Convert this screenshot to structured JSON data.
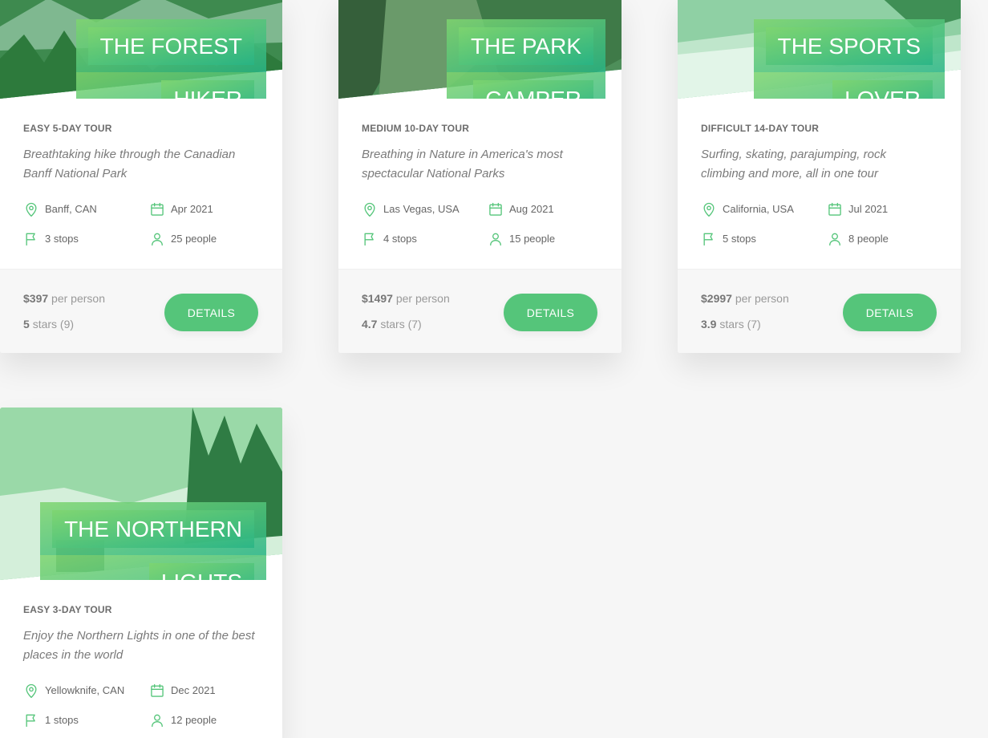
{
  "colors": {
    "accent": "#55c57a",
    "gradient_start": "#7ed56f",
    "gradient_end": "#28b485",
    "background": "#f6f6f6"
  },
  "icons": {
    "location": "map-pin-icon",
    "date": "calendar-icon",
    "stops": "flag-icon",
    "people": "user-icon"
  },
  "tours": [
    {
      "title_lines": [
        "THE FOREST",
        "HIKER"
      ],
      "subtitle": "EASY 5-DAY TOUR",
      "description": "Breathtaking hike through the Canadian Banff National Park",
      "location": "Banff, CAN",
      "date": "Apr 2021",
      "stops": "3 stops",
      "people": "25 people",
      "price": "$397",
      "price_unit": "per person",
      "rating_value": "5",
      "rating_unit": "stars",
      "rating_count": "(9)",
      "button_label": "DETAILS"
    },
    {
      "title_lines": [
        "THE PARK",
        "CAMPER"
      ],
      "subtitle": "MEDIUM 10-DAY TOUR",
      "description": "Breathing in Nature in America's most spectacular National Parks",
      "location": "Las Vegas, USA",
      "date": "Aug 2021",
      "stops": "4 stops",
      "people": "15 people",
      "price": "$1497",
      "price_unit": "per person",
      "rating_value": "4.7",
      "rating_unit": "stars",
      "rating_count": "(7)",
      "button_label": "DETAILS"
    },
    {
      "title_lines": [
        "THE SPORTS",
        "LOVER"
      ],
      "subtitle": "DIFFICULT 14-DAY TOUR",
      "description": "Surfing, skating, parajumping, rock climbing and more, all in one tour",
      "location": "California, USA",
      "date": "Jul 2021",
      "stops": "5 stops",
      "people": "8 people",
      "price": "$2997",
      "price_unit": "per person",
      "rating_value": "3.9",
      "rating_unit": "stars",
      "rating_count": "(7)",
      "button_label": "DETAILS"
    },
    {
      "title_lines": [
        "THE NORTHERN",
        "LIGHTS"
      ],
      "subtitle": "EASY 3-DAY TOUR",
      "description": "Enjoy the Northern Lights in one of the best places in the world",
      "location": "Yellowknife, CAN",
      "date": "Dec 2021",
      "stops": "1 stops",
      "people": "12 people",
      "price": "",
      "price_unit": "",
      "rating_value": "",
      "rating_unit": "",
      "rating_count": "",
      "button_label": ""
    }
  ]
}
